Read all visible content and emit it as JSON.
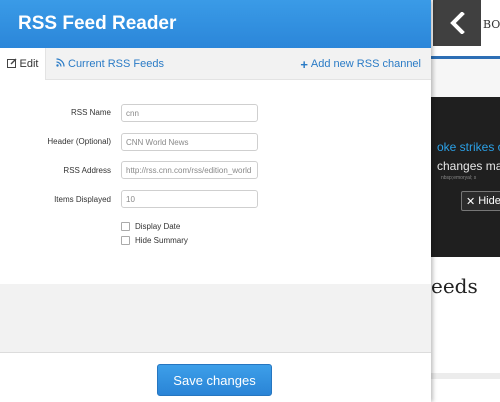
{
  "modal": {
    "title": "RSS Feed Reader",
    "tabs": {
      "edit": {
        "label": "Edit",
        "icon": "pencil-icon"
      },
      "feeds": {
        "label": "Current RSS Feeds",
        "icon": "rss-icon"
      }
    },
    "add_channel_label": "Add new RSS channel",
    "form": {
      "rss_name": {
        "label": "RSS Name",
        "value": "cnn"
      },
      "header": {
        "label": "Header (Optional)",
        "value": "CNN World News"
      },
      "rss_address": {
        "label": "RSS Address",
        "value": "http://rss.cnn.com/rss/edition_world"
      },
      "items_displayed": {
        "label": "Items Displayed",
        "value": "10"
      },
      "display_date": {
        "label": "Display Date",
        "checked": false
      },
      "hide_summary": {
        "label": "Hide Summary",
        "checked": false
      }
    },
    "save_label": "Save changes"
  },
  "background": {
    "top_text": "BOU",
    "banner_line1": "oke strikes o",
    "banner_line2": "changes may l",
    "banner_line3": "nbsp;emoryal; s",
    "hide_label": "Hide",
    "heading": "eeds"
  },
  "colors": {
    "header_blue": "#2b86d9",
    "link_blue": "#2a7bc6",
    "back_button_dark": "#404040",
    "banner_dark": "#1f1f1f"
  }
}
